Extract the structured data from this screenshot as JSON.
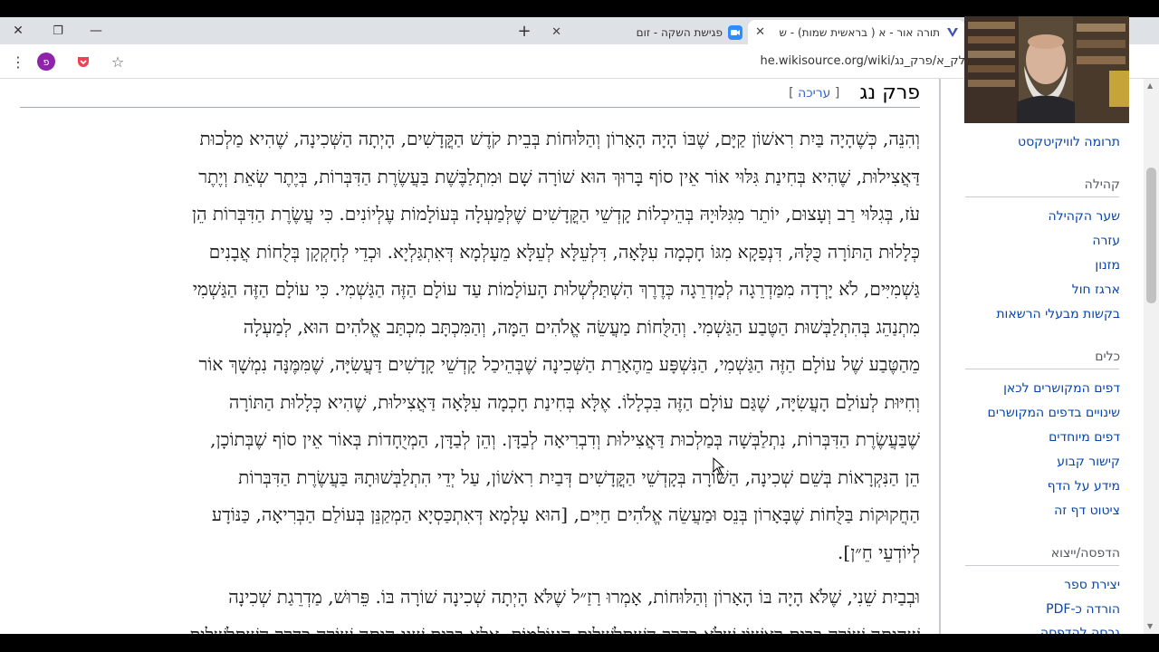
{
  "browser": {
    "window_controls": {
      "close": "✕",
      "restore": "❐",
      "minimize": "—"
    },
    "tabs": [
      {
        "title": "תורה אור - א ( בראשית שמות) - ש",
        "active": true
      },
      {
        "title": "פגישת השקה - זום",
        "active": false
      }
    ],
    "url": "he.wikisource.org/wiki/לק_א/פרק_נג",
    "profile_letter": "פ"
  },
  "page": {
    "title": "פרק נג",
    "edit_open": "[",
    "edit_label": "עריכה",
    "edit_close": "]",
    "paragraph1_lines": [
      "וְהִנֵּה, כְּשֶׁהָיָה בַּיִת רִאשׁוֹן קַיָּם, שֶׁבּוֹ הָיָה הָאָרוֹן וְהַלּוּחוֹת בְּבֵית קֹדֶשׁ הַקֳּדָשִׁים, הָיְתָה הַשְּׁכִינָה, שֶׁהִיא מַלְכוּת",
      "דַּאֲצִילוּת, שֶׁהִיא בְּחִינַת גִּלּוּי אוֹר אֵין סוֹף בָּרוּךְ הוּא שׁוֹרָה שָׁם וּמִתְלַבֶּשֶׁת בַּעֲשֶׂרֶת הַדִּבְּרוֹת, בְּיֶתֶר שְׂאֵת וְיֶתֶר",
      "עֹז, בְּגִלּוּי רַב וְעָצוּם, יוֹתֵר מִגִּלּוּיָהּ בְּהֵיכְלוֹת קָדְשֵׁי הַקֳּדָשִׁים שֶׁלְּמַעְלָה בְּעוֹלָמוֹת עֶלְיוֹנִים. כִּי עֲשֶׂרֶת הַדִּבְּרוֹת הֵן",
      "כְּלָלוּת הַתּוֹרָה כֻּלָּהּ, דִּנְפַקָא מִגּוֹ חָכְמָה עִלָּאָה, דִּלְעֵלָּא לְעֵלָּא מֵעָלְמָא דְּאִתְגַּלְיָא. וּכְדֵי לְחָקְקָן בְּלֻחוֹת אֲבָנִים",
      "גַּשְׁמִיִּים, לֹא יָרְדָה מִמַּדְרֵגָה לְמַדְרֵגָה כְּדֶרֶךְ הִשְׁתַּלְשְׁלוּת הָעוֹלָמוֹת עַד עוֹלָם הַזֶּה הַגַּשְׁמִי. כִּי עוֹלָם הַזֶּה הַגַּשְׁמִי",
      "מִתְנַהֵג בְּהִתְלַבְּשׁוּת הַטֶּבַע הַגַּשְׁמִי. וְהַלֻּחוֹת מַעֲשֵׂה אֱלֹהִים הֵמָּה, וְהַמִּכְתָּב מִכְתַּב אֱלֹהִים הוּא, לְמַעְלָה",
      "מֵהַטֶּבַע שֶׁל עוֹלָם הַזֶּה הַגַּשְׁמִי, הַנִּשְׁפָּע מֵהֶאָרַת הַשְּׁכִינָה שֶׁבְּהֵיכַל קָדְשֵׁי קָדָשִׁים דַּעֲשִׂיָּה, שֶׁמִּמֶּנָּה נִמְשָׁךְ אוֹר",
      "וְחִיּוּת לְעוֹלַם הָעֲשִׂיָּה, שֶׁגַּם עוֹלָם הַזֶּה בִּכְלָלוֹ. אֶלָּא בְּחִינַת חָכְמָה עִלָּאָה דַּאֲצִילוּת, שֶׁהִיא כְּלָלוּת הַתּוֹרָה",
      "שֶׁבַּעֲשֶׂרֶת הַדִּבְּרוֹת, נִתְלַבְּשָׁה בְּמַלְכוּת דַּאֲצִילוּת וְדִבְרִיאָה לְבַדָּן. וְהֵן לְבַדָּן, הַמְיֻחָדוֹת בְּאוֹר אֵין סוֹף שֶׁבְּתוֹכָן,",
      "הֵן הַנִּקְרָאוֹת בְּשֵׁם שְׁכִינָה, הַשּׁוֹרָה בְּקָדְשֵׁי הַקֳּדָשִׁים דְּבַיִת רִאשׁוֹן, עַל יְדֵי הִתְלַבְּשׁוּתָהּ בַּעֲשֶׂרֶת הַדִּבְּרוֹת",
      "הַחֲקוּקוֹת בַּלֻּחוֹת שֶׁבָּאָרוֹן בְּנֵס וּמַעֲשֵׂה אֱלֹהִים חַיִּים, [הוּא עָלְמָא דְּאִתְכַּסְיָא הַמְקַנֵּן בְּעוֹלַם הַבְּרִיאָה, כַּנּוֹדָע",
      "לְיוֹדְעֵי חֵ״ן]."
    ],
    "paragraph2_lines": [
      "וּבְבַיִת שֵׁנִי, שֶׁלֹּא הָיָה בּוֹ הָאָרוֹן וְהַלּוּחוֹת, אָמְרוּ רַזַ״ל שֶׁלֹּא הָיְתָה שְׁכִינָה שׁוֹרָה בּוֹ. פֵּרוּשׁ, מַדְרֵגַת שְׁכִינָה",
      "שֶׁהָיְתָה שׁוֹרָה בְּבַיִת רִאשׁוֹן שֶׁלֹּא כְּדֶרֶךְ הִשְׁתַּלְשְׁלוּת הָעוֹלָמוֹת, אֶלָּא בְּבַיִת שֵׁנִי הָיְתָה שׁוֹרָה כְּדֶרֶךְ הִשְׁתַּלְשְׁלוּת"
    ]
  },
  "sidebar": {
    "donate": "תרומה לוויקיטקסט",
    "community_heading": "קהילה",
    "community_items": [
      "שער הקהילה",
      "עזרה",
      "מזנון",
      "ארגז חול",
      "בקשות מבעלי הרשאות"
    ],
    "tools_heading": "כלים",
    "tools_items": [
      "דפים המקושרים לכאן",
      "שינויים בדפים המקושרים",
      "דפים מיוחדים",
      "קישור קבוע",
      "מידע על הדף",
      "ציטוט דף זה"
    ],
    "print_heading": "הדפסה/ייצוא",
    "print_items": [
      "יצירת ספר",
      "הורדה כ-PDF",
      "גרסה להדפסה"
    ]
  },
  "colors": {
    "link": "#0645ad",
    "edit_link": "#3366cc",
    "tabstrip": "#dee1e6",
    "text": "#202122"
  }
}
